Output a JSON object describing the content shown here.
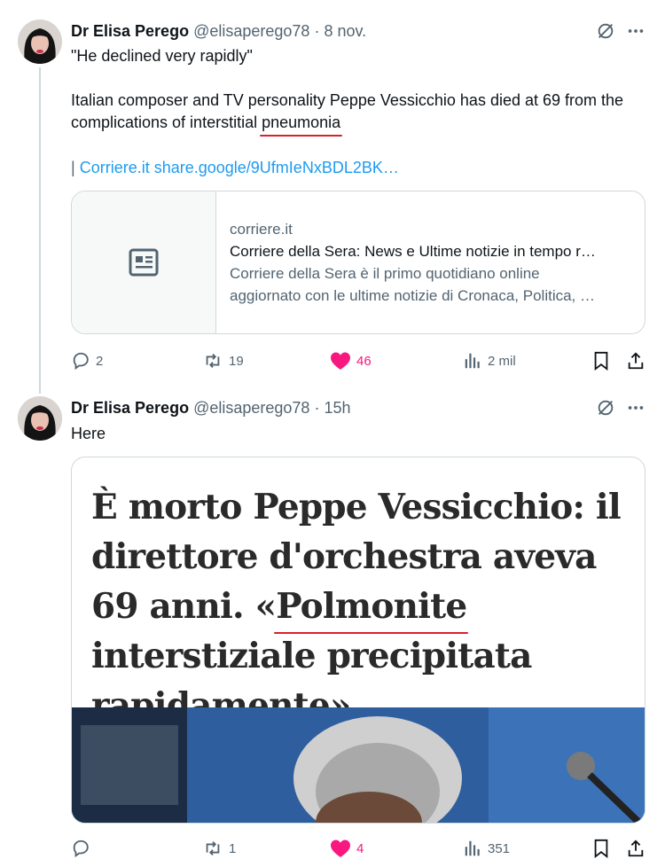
{
  "tweets": [
    {
      "author_name": "Dr Elisa Perego",
      "handle": "@elisaperego78",
      "separator": "·",
      "time": "8 nov.",
      "quote_line": "\"He declined very rapidly\"",
      "body_part1": "Italian composer and TV personality Peppe Vessicchio has died at 69 from the complications of interstitial",
      "body_highlight": "pneumonia",
      "link_prefix": "|",
      "link_text": "Corriere.it share.google/9UfmIeNxBDL2BK…",
      "card": {
        "domain": "corriere.it",
        "title": "Corriere della Sera: News e Ultime notizie in tempo r…",
        "description_line1": "Corriere della Sera è il primo quotidiano online",
        "description_line2": "aggiornato con le ultime notizie di Cronaca, Politica, …"
      },
      "replies": "2",
      "reposts": "19",
      "likes": "46",
      "views": "2 mil"
    },
    {
      "author_name": "Dr Elisa Perego",
      "handle": "@elisaperego78",
      "separator": "·",
      "time": "15h",
      "body": "Here",
      "media_headline_before": "È morto Peppe Vessicchio: il direttore d'orchestra aveva 69 anni. «",
      "media_headline_highlight": "Polmonite",
      "media_headline_after": " interstiziale precipitata rapidamente»",
      "replies": "",
      "reposts": "1",
      "likes": "4",
      "views": "351"
    }
  ],
  "colors": {
    "text": "#0f1419",
    "secondary": "#536471",
    "link": "#1d9bf0",
    "like": "#f91880",
    "highlight_underline": "#d8222b",
    "border": "#cfd9de"
  },
  "icons": {
    "avatar": "avatar",
    "grok": "grok-icon",
    "more": "more-icon",
    "reply": "reply-icon",
    "repost": "repost-icon",
    "like": "heart-icon",
    "views": "views-icon",
    "bookmark": "bookmark-icon",
    "share": "share-icon",
    "card_placeholder": "article-icon"
  }
}
